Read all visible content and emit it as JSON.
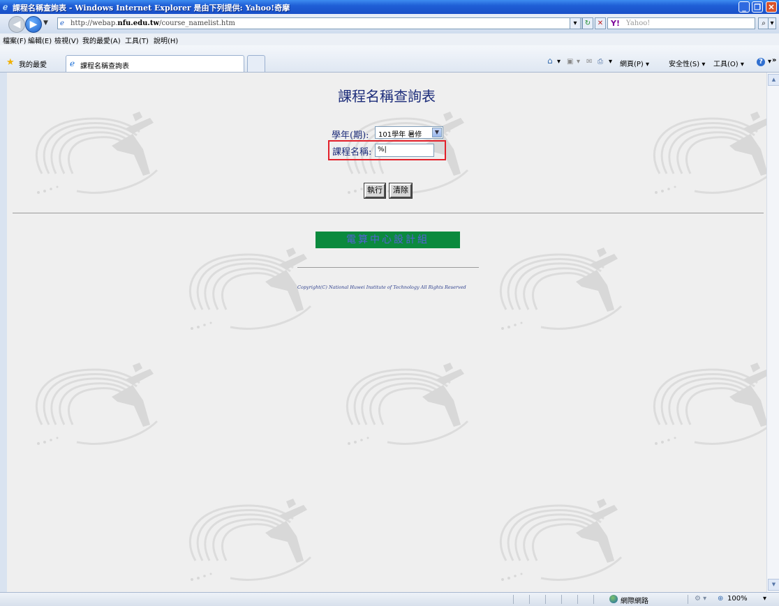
{
  "window": {
    "title": "課程名稱查詢表 - Windows Internet Explorer 是由下列提供: Yahoo!奇摩"
  },
  "nav": {
    "url_prefix": "http://webap.",
    "url_domain": "nfu.edu.tw",
    "url_path": "/course_namelist.htm",
    "search_placeholder": "Yahoo!",
    "search_logo": "Y!"
  },
  "menu": [
    "檔案(F)",
    "編輯(E)",
    "檢視(V)",
    "我的最愛(A)",
    "工具(T)",
    "說明(H)"
  ],
  "favorites": {
    "label": "我的最愛",
    "tab_label": "課程名稱查詢表"
  },
  "command_bar": {
    "page": "網頁(P)",
    "safety": "安全性(S)",
    "tools": "工具(O)"
  },
  "page": {
    "title": "課程名稱查詢表",
    "term_label": "學年(期):",
    "term_value": "101學年 暑修",
    "course_label": "課程名稱:",
    "course_value": "%",
    "execute_button": "執行",
    "clear_button": "清除",
    "banner": "電算中心設計組",
    "copyright": "Copyright(C) National Huwei Institute of Technology All Rights Reserved"
  },
  "status": {
    "zone": "網際網路",
    "zoom": "100%"
  },
  "colors": {
    "title_text": "#1c2c7a",
    "banner_bg": "#0b8a3e",
    "highlight_border": "#e3202a"
  }
}
